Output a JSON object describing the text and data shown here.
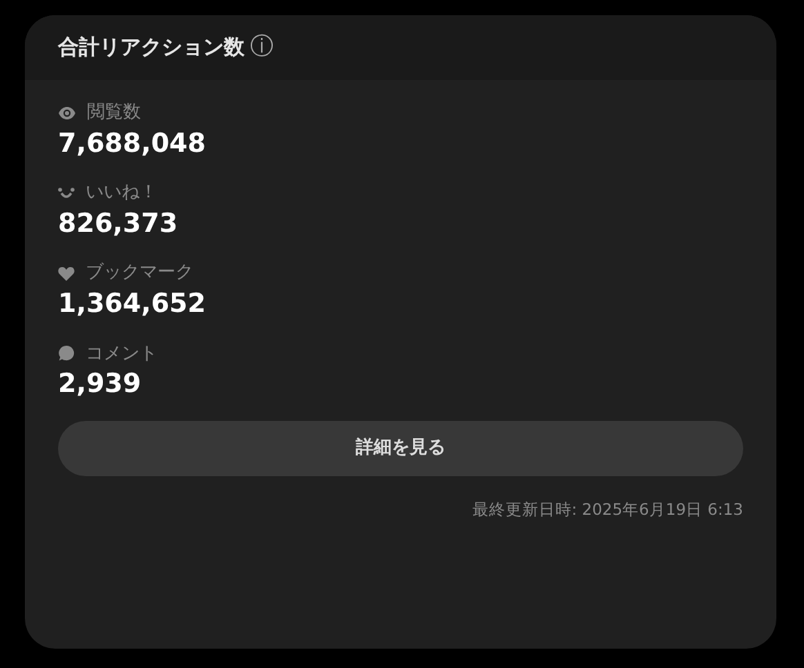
{
  "card": {
    "title": "合計リアクション数",
    "info_icon": "ⓘ"
  },
  "stats": [
    {
      "kind": "views",
      "label": "閲覧数",
      "value": "7,688,048"
    },
    {
      "kind": "likes",
      "label": "いいね！",
      "value": "826,373"
    },
    {
      "kind": "bookmarks",
      "label": "ブックマーク",
      "value": "1,364,652"
    },
    {
      "kind": "comments",
      "label": "コメント",
      "value": "2,939"
    }
  ],
  "button": "詳細を見る",
  "updated": "最終更新日時: 2025年6月19日 6:13"
}
